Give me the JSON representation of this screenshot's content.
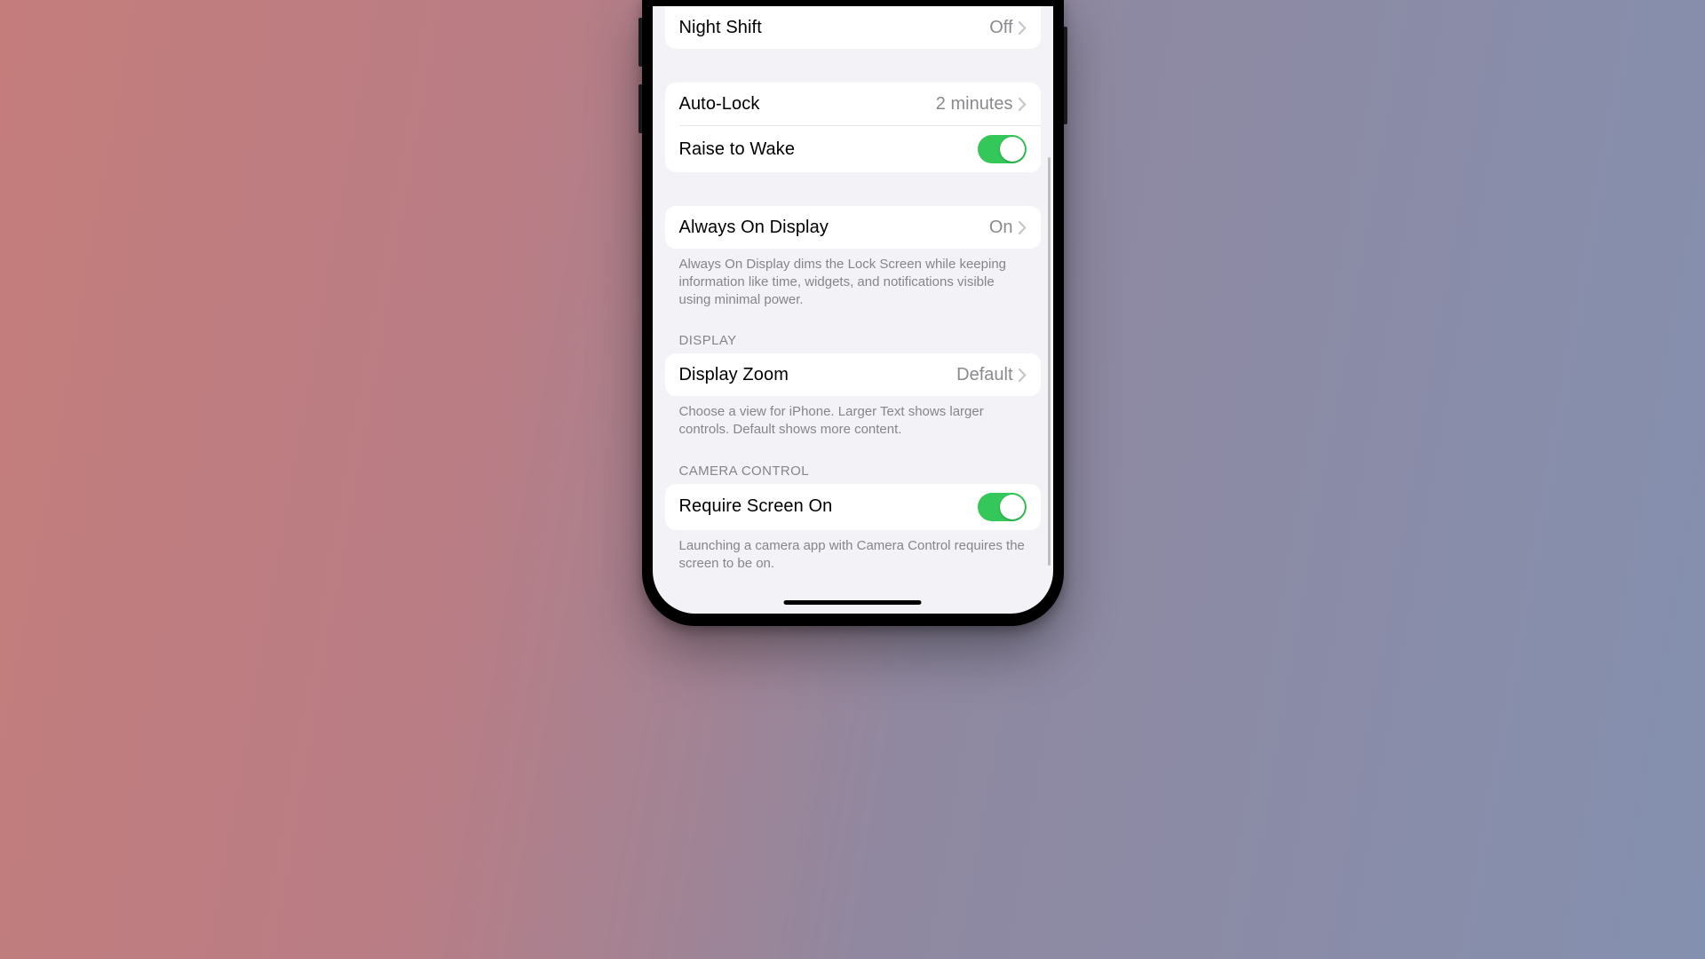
{
  "colors": {
    "toggle_on": "#34c759",
    "bg": "#f2f2f7",
    "card": "#ffffff"
  },
  "groups": [
    {
      "rows": [
        {
          "id": "night-shift",
          "label": "Night Shift",
          "value": "Off",
          "type": "nav"
        }
      ]
    },
    {
      "rows": [
        {
          "id": "auto-lock",
          "label": "Auto-Lock",
          "value": "2 minutes",
          "type": "nav"
        },
        {
          "id": "raise-to-wake",
          "label": "Raise to Wake",
          "on": true,
          "type": "toggle"
        }
      ]
    },
    {
      "rows": [
        {
          "id": "always-on-display",
          "label": "Always On Display",
          "value": "On",
          "type": "nav"
        }
      ],
      "footer": "Always On Display dims the Lock Screen while keeping information like time, widgets, and notifications visible using minimal power."
    },
    {
      "header": "DISPLAY",
      "rows": [
        {
          "id": "display-zoom",
          "label": "Display Zoom",
          "value": "Default",
          "type": "nav"
        }
      ],
      "footer": "Choose a view for iPhone. Larger Text shows larger controls. Default shows more content."
    },
    {
      "header": "CAMERA CONTROL",
      "rows": [
        {
          "id": "require-screen-on",
          "label": "Require Screen On",
          "on": true,
          "type": "toggle"
        }
      ],
      "footer": "Launching a camera app with Camera Control requires the screen to be on."
    }
  ]
}
